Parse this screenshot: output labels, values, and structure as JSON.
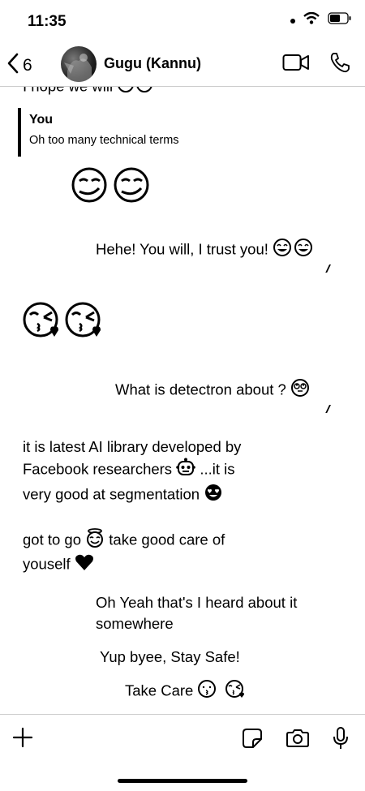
{
  "status_bar": {
    "time": "11:35"
  },
  "header": {
    "back_count": "6",
    "contact_name": "Gugu (Kannu)"
  },
  "messages": {
    "partial_top": "I hope we will",
    "reply_quote": {
      "sender": "You",
      "text": "Oh too many technical terms"
    },
    "m1_text": "Hehe! You will, I trust you!",
    "m2_text": "What is detectron about ?",
    "m3_line1": "it is latest AI library developed by",
    "m3_line2a": "Facebook researchers",
    "m3_line2b": "...it is",
    "m3_line3": "very good at segmentation",
    "m4_line1a": "got to go",
    "m4_line1b": "take good care of",
    "m4_line2": "youself",
    "m5_line1": "Oh Yeah that's I heard about it",
    "m5_line2": "somewhere",
    "m6_text": "Yup byee, Stay Safe!",
    "m7_text": "Take Care",
    "ticks": "//"
  },
  "icons": [
    "back-chevron-icon",
    "video-call-icon",
    "phone-call-icon",
    "plus-icon",
    "sticker-icon",
    "camera-icon",
    "microphone-icon",
    "wifi-icon",
    "battery-icon",
    "signal-icon"
  ]
}
